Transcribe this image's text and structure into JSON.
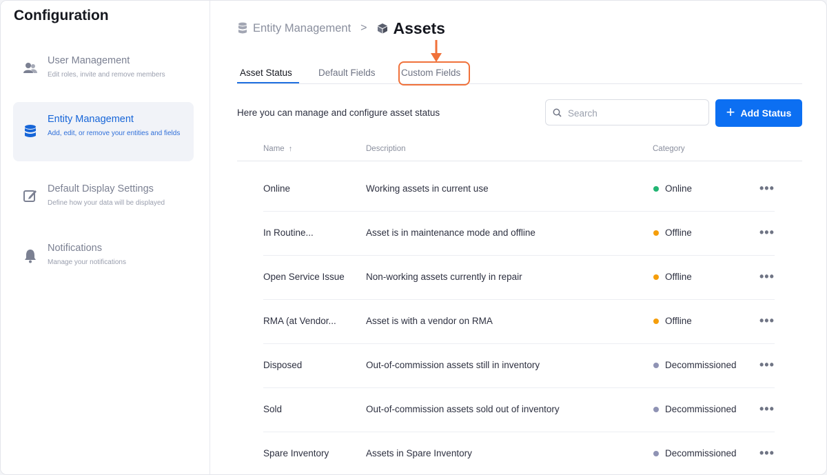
{
  "sidebar": {
    "title": "Configuration",
    "items": [
      {
        "label": "User Management",
        "desc": "Edit roles, invite and remove members",
        "icon": "users-icon"
      },
      {
        "label": "Entity Management",
        "desc": "Add, edit, or remove your entities and fields",
        "icon": "database-icon",
        "active": true
      },
      {
        "label": "Default Display Settings",
        "desc": "Define how your data will be displayed",
        "icon": "edit-icon"
      },
      {
        "label": "Notifications",
        "desc": "Manage your notifications",
        "icon": "bell-icon"
      }
    ]
  },
  "breadcrumb": {
    "parent": "Entity Management",
    "separator": ">",
    "current": "Assets"
  },
  "tabs": [
    "Asset Status",
    "Default Fields",
    "Custom Fields"
  ],
  "intro": "Here you can manage and configure asset status",
  "search": {
    "placeholder": "Search"
  },
  "add_button": {
    "plus": "+",
    "label": "Add Status"
  },
  "table": {
    "headers": {
      "name": "Name",
      "sort": "↑",
      "description": "Description",
      "category": "Category"
    },
    "rows": [
      {
        "name": "Online",
        "description": "Working assets in current use",
        "category": "Online",
        "color": "#22b573"
      },
      {
        "name": "In Routine...",
        "description": "Asset is in maintenance mode and offline",
        "category": "Offline",
        "color": "#f59e0b"
      },
      {
        "name": "Open Service Issue",
        "description": "Non-working assets currently in repair",
        "category": "Offline",
        "color": "#f59e0b"
      },
      {
        "name": "RMA (at Vendor...",
        "description": "Asset is with a vendor on RMA",
        "category": "Offline",
        "color": "#f59e0b"
      },
      {
        "name": "Disposed",
        "description": "Out-of-commission assets still in inventory",
        "category": "Decommissioned",
        "color": "#8f93b4"
      },
      {
        "name": "Sold",
        "description": "Out-of-commission assets sold out of inventory",
        "category": "Decommissioned",
        "color": "#8f93b4"
      },
      {
        "name": "Spare Inventory",
        "description": "Assets in Spare Inventory",
        "category": "Decommissioned",
        "color": "#8f93b4"
      }
    ],
    "row_menu": "•••"
  },
  "colors": {
    "accent": "#0c6ff2",
    "highlight": "#f0713a"
  }
}
